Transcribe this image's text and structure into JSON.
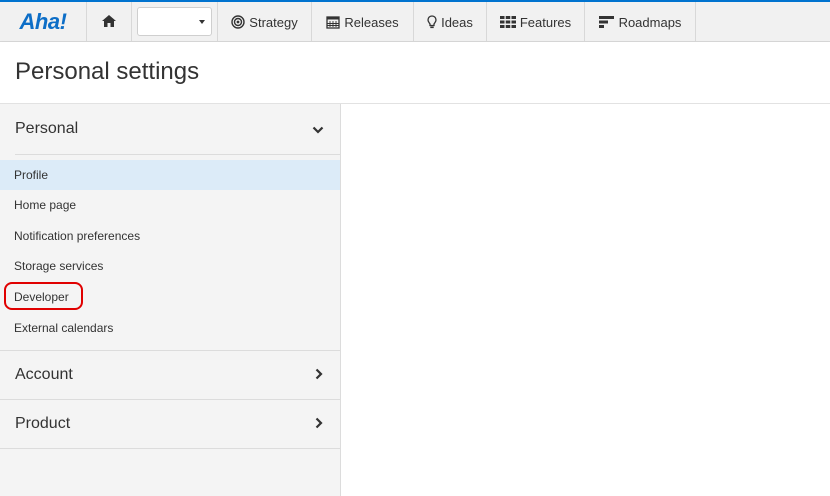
{
  "brand": {
    "logo_text": "Aha!"
  },
  "nav": {
    "home_icon": "home-icon",
    "workspace_select_value": "",
    "items": [
      {
        "label": "Strategy",
        "icon": "target-icon"
      },
      {
        "label": "Releases",
        "icon": "calendar-icon"
      },
      {
        "label": "Ideas",
        "icon": "lightbulb-icon"
      },
      {
        "label": "Features",
        "icon": "grid-icon"
      },
      {
        "label": "Roadmaps",
        "icon": "roadmap-bars-icon"
      }
    ]
  },
  "page": {
    "title": "Personal settings"
  },
  "sidebar": {
    "personal": {
      "label": "Personal",
      "expanded": true,
      "items": [
        {
          "label": "Profile",
          "active": true
        },
        {
          "label": "Home page"
        },
        {
          "label": "Notification preferences"
        },
        {
          "label": "Storage services"
        },
        {
          "label": "Developer",
          "highlighted": true
        },
        {
          "label": "External calendars"
        }
      ]
    },
    "account": {
      "label": "Account",
      "expanded": false
    },
    "product": {
      "label": "Product",
      "expanded": false
    }
  },
  "colors": {
    "brand_blue": "#0d6ec7",
    "active_item_bg": "#dcebf8",
    "highlight_ring": "#e00000"
  }
}
